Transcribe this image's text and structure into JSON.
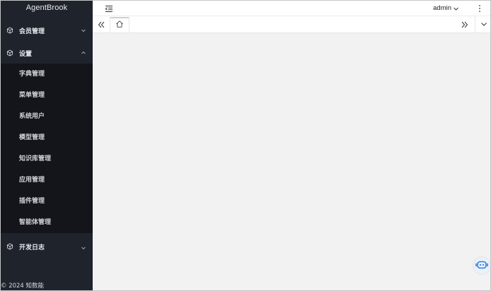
{
  "app": {
    "logo": "AgentBrook"
  },
  "sidebar": {
    "groups": [
      {
        "label": "会员管理",
        "icon": "cube-icon",
        "expanded": false
      },
      {
        "label": "设置",
        "icon": "cube-icon",
        "expanded": true
      },
      {
        "label": "开发日志",
        "icon": "cube-icon",
        "expanded": false
      }
    ],
    "settings_items": [
      {
        "label": "字典管理"
      },
      {
        "label": "菜单管理"
      },
      {
        "label": "系统用户"
      },
      {
        "label": "模型管理"
      },
      {
        "label": "知识库管理"
      },
      {
        "label": "应用管理"
      },
      {
        "label": "插件管理"
      },
      {
        "label": "智能体管理"
      }
    ],
    "footer": "© 2024 知数能"
  },
  "header": {
    "username": "admin",
    "collapse_icon": "menu-fold-icon",
    "more_icon": "more-vertical-icon"
  },
  "tabs": {
    "home_icon": "home-icon",
    "scroll_left_icon": "double-chevron-left-icon",
    "scroll_right_icon": "double-chevron-right-icon",
    "menu_icon": "chevron-down-icon"
  },
  "colors": {
    "sidebar_bg": "#1f232c",
    "submenu_bg": "#13151a",
    "content_bg": "#f2f2f2",
    "header_bg": "#ffffff",
    "bot_accent": "#2f7fd8"
  }
}
